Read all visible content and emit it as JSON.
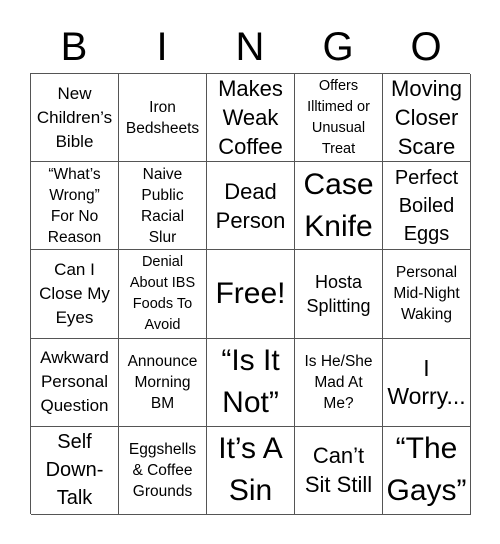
{
  "header": {
    "letters": [
      "B",
      "I",
      "N",
      "G",
      "O"
    ]
  },
  "cells": [
    "New\nChildren’s\nBible",
    "Iron\nBedsheets",
    "Makes\nWeak\nCoffee",
    "Offers\nIlltimed or\nUnusual\nTreat",
    "Moving\nCloser\nScare",
    "“What’s\nWrong”\nFor No\nReason",
    "Naive\nPublic\nRacial\nSlur",
    "Dead\nPerson",
    "Case\nKnife",
    "Perfect\nBoiled\nEggs",
    "Can I\nClose My\nEyes",
    "Denial\nAbout IBS\nFoods To\nAvoid",
    "Free!",
    "Hosta\nSplitting",
    "Personal\nMid-Night\nWaking",
    "Awkward\nPersonal\nQuestion",
    "Announce\nMorning\nBM",
    "“Is It\nNot”",
    "Is He/She\nMad At\nMe?",
    "I\nWorry...",
    "Self\nDown-\nTalk",
    "Eggshells\n& Coffee\nGrounds",
    "It’s A\nSin",
    "Can’t\nSit Still",
    "“The\nGays”"
  ]
}
